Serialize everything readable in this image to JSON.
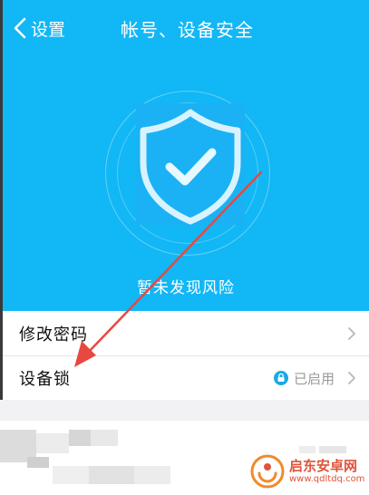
{
  "nav": {
    "back_label": "设置",
    "title": "帐号、设备安全"
  },
  "hero": {
    "status_text": "暂未发现风险",
    "icon": "shield-check-icon"
  },
  "list": {
    "change_password": {
      "label": "修改密码"
    },
    "device_lock": {
      "label": "设备锁",
      "value": "已启用"
    }
  },
  "watermark": {
    "title": "启东安卓网",
    "url": "www.qdltdq.com"
  },
  "colors": {
    "header_bg": "#12b7f5",
    "annotation_arrow": "#e8483f",
    "lock_badge": "#1aa9e8",
    "secondary_text": "#9a9a9a"
  }
}
